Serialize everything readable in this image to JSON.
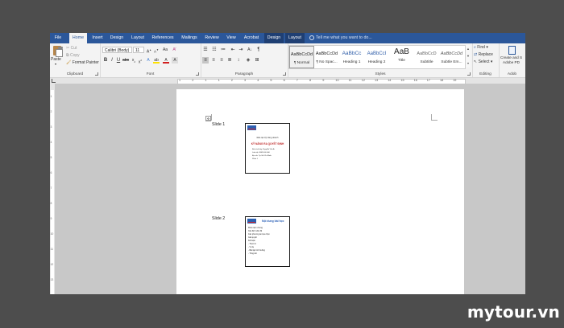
{
  "tabs": [
    "File",
    "Home",
    "Insert",
    "Design",
    "Layout",
    "References",
    "Mailings",
    "Review",
    "View",
    "Acrobat",
    "Design",
    "Layout"
  ],
  "active_tab": "Home",
  "tell_me": "Tell me what you want to do...",
  "clipboard": {
    "paste": "Paste",
    "cut": "Cut",
    "copy": "Copy",
    "format_painter": "Format Painter",
    "label": "Clipboard"
  },
  "font": {
    "name": "Calibri (Body)",
    "size": "11",
    "label": "Font"
  },
  "paragraph": {
    "label": "Paragraph"
  },
  "styles": {
    "label": "Styles",
    "items": [
      {
        "sample": "AaBbCcDd",
        "name": "¶ Normal"
      },
      {
        "sample": "AaBbCcDd",
        "name": "¶ No Spac..."
      },
      {
        "sample": "AaBbCc",
        "name": "Heading 1"
      },
      {
        "sample": "AaBbCcI",
        "name": "Heading 2"
      },
      {
        "sample": "AaB",
        "name": "Title"
      },
      {
        "sample": "AaBbCcD",
        "name": "Subtitle"
      },
      {
        "sample": "AaBbCcDd",
        "name": "Subtle Em..."
      }
    ]
  },
  "editing": {
    "find": "Find",
    "replace": "Replace",
    "select": "Select",
    "label": "Editing"
  },
  "adobe": {
    "line1": "Create and S",
    "line2": "Adobe PD",
    "label": "Adob"
  },
  "ruler_numbers": [
    "1",
    "2",
    "1",
    "1",
    "2",
    "3",
    "4",
    "5",
    "6",
    "7",
    "8",
    "9",
    "10",
    "11",
    "12",
    "13",
    "14",
    "15",
    "16",
    "17",
    "18",
    "19"
  ],
  "vruler_numbers": [
    "1",
    "2",
    "3",
    "4",
    "5",
    "6",
    "7",
    "8",
    "9",
    "10",
    "11",
    "12",
    "13"
  ],
  "slides": [
    {
      "label": "Slide 1",
      "line1": "Đào tạo kỹ năng doanh",
      "title": "KỸ NĂNG RA QUYẾT ĐỊNH",
      "lines": [
        "Bài trình bày: Nguyễn Văn A",
        "Liên hệ: 0909 000 000",
        "Địa chỉ: Tp. Hồ Chí Minh",
        "Phần 1"
      ]
    },
    {
      "label": "Slide 2",
      "title": "Nội dung bài học",
      "bullets": [
        "Khái niệm chung",
        "Xác định vấn đề",
        "Các phương án lựa chọn",
        "Giải quyết",
        "Kết luận",
        "- Thực tế",
        "- Ví dụ",
        "- Bài tập tình huống",
        "- Tổng kết"
      ]
    }
  ],
  "watermark": {
    "brand": "mytour",
    "tld": ".vn"
  }
}
